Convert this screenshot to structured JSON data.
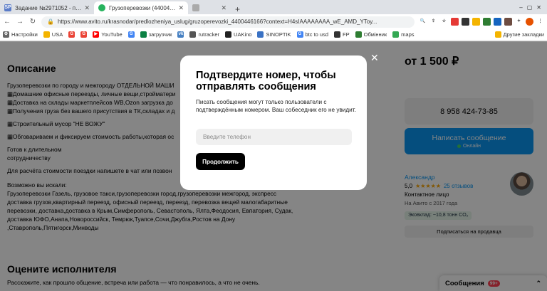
{
  "browser": {
    "tabs": [
      {
        "favicon": "SP",
        "favicon_color": "#5b7cc8",
        "title": "Задание №2971052 - просмотр з"
      },
      {
        "favicon": "",
        "favicon_color": "#26b35d",
        "title": "Грузоперевозки (4400446166)"
      },
      {
        "favicon": "",
        "favicon_color": "#aaaaaa",
        "title": ""
      }
    ],
    "new_tab": "+",
    "url": "https://www.avito.ru/krasnodar/predlozheniya_uslug/gruzoperevozki_4400446166?context=H4sIAAAAAAAA_wE_AMD_YToy..."
  },
  "bookmarks": [
    {
      "label": "Настройки",
      "color": "#666666",
      "icon": "⚙"
    },
    {
      "label": "USA",
      "color": "#f4b400",
      "icon": ""
    },
    {
      "label": "",
      "color": "#ea4335",
      "icon": "G"
    },
    {
      "label": "",
      "color": "#ea4335",
      "icon": "G"
    },
    {
      "label": "YouTube",
      "color": "#ff0000",
      "icon": "▶"
    },
    {
      "label": "",
      "color": "#4285f4",
      "icon": "G"
    },
    {
      "label": "загрузчик",
      "color": "#0b8043",
      "icon": ""
    },
    {
      "label": "",
      "color": "#4680c2",
      "icon": "vk"
    },
    {
      "label": "rutracker",
      "color": "#555555",
      "icon": ""
    },
    {
      "label": "UAKino",
      "color": "#222222",
      "icon": ""
    },
    {
      "label": "SINOPTIK",
      "color": "#3a72c4",
      "icon": ""
    },
    {
      "label": "btc to usd",
      "color": "#4285f4",
      "icon": "G"
    },
    {
      "label": "FP",
      "color": "#333333",
      "icon": ""
    },
    {
      "label": "Обмінник",
      "color": "#2e7d32",
      "icon": ""
    },
    {
      "label": "maps",
      "color": "#34a853",
      "icon": ""
    }
  ],
  "bookmarks_other": "Другие закладки",
  "page": {
    "description_title": "Описание",
    "description_lines": [
      "Грузоперевозки по городу и межгороду ОТДЕЛЬНОЙ МАШИ",
      "▦Домашние офисные переезды, личные вещи,стройматери",
      "▦Доставка на склады маркетплейсов WB,Ozon загрузка до",
      "▦Получения груза без вашего присутствия в ТК,складах и д",
      "",
      "▦Строительный мусор \"НЕ ВОЖУ\"",
      "",
      "▦Обговариваем и фиксируем стоимость работы,которая ос",
      "",
      "Готов к длительном",
      "сотрудничеству",
      "",
      "Для расчёта стоимости поездки напишете в чат или позвон"
    ],
    "destinations_lines": [
      "Возможно вы искали:",
      "Грузоперевозки Газель, грузовое такси,грузоперевозки город,грузоперевозки межгород, экспресс",
      "доставка грузов,квартирный переезд, офисный переезд, переезд, перевозка вещей малогабаритные",
      "перевозки, доставка,доставка в Крым,Симферополь, Севастополь, Ялта,Феодосия, Евпатория, Судак,",
      "доставка ЮФО,Анапа,Новороссийск, Темрюк,Туапсе,Сочи,Джубга,Ростов на Дону",
      ",Ставрополь,Пятигорск,Минводы"
    ],
    "rate_title": "Оцените исполнителя",
    "rate_subtitle": "Расскажите, как прошло общение, встреча или работа — что понравилось, а что не очень.",
    "price": "от 1 500 ₽",
    "phone": "8 958 424-73-85",
    "message_button": "Написать сообщение",
    "online_status": "Онлайн",
    "seller": {
      "name": "Александр",
      "rating": "5,0",
      "stars": "★★★★★",
      "reviews": "25 отзывов",
      "role": "Контактное лицо",
      "since": "На Авито с 2017 года",
      "eco": "Эковклад: ~10,8 тонн CO₂"
    },
    "subscribe": "Подписаться на продавца",
    "messages": {
      "label": "Сообщения",
      "count": "99+"
    }
  },
  "modal": {
    "title": "Подтвердите номер, чтобы отправлять сообщения",
    "text": "Писать сообщения могут только пользователи с подтверждённым номером. Ваш собеседник его не увидит.",
    "input_placeholder": "Введите телефон",
    "input_value": "",
    "continue_button": "Продолжить",
    "close": "✕"
  }
}
